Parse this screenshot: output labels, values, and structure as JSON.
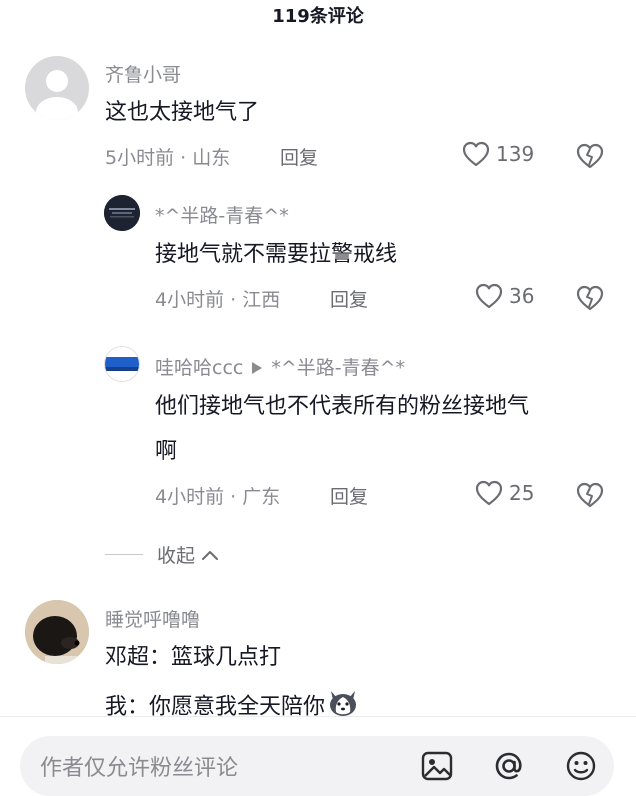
{
  "header": {
    "title": "119条评论"
  },
  "comments": [
    {
      "user": "齐鲁小哥",
      "text": "这也太接地气了",
      "meta": "5小时前 · 山东",
      "reply_label": "回复",
      "likes": "139"
    },
    {
      "user": "*^半路-青春^*",
      "text": "接地气就不需要拉警戒线",
      "meta": "4小时前 · 江西",
      "reply_label": "回复",
      "likes": "36"
    },
    {
      "user": "哇哈哈ccc",
      "reply_to": "*^半路-青春^*",
      "text_line1": "他们接地气也不代表所有的粉丝接地气",
      "text_line2": "啊",
      "meta": "4小时前 · 广东",
      "reply_label": "回复",
      "likes": "25"
    },
    {
      "user": "睡觉呼噜噜",
      "text_line1": "邓超：篮球几点打",
      "text_line2": "我：你愿意我全天陪你"
    }
  ],
  "collapse_label": "收起",
  "input": {
    "placeholder": "作者仅允许粉丝评论"
  },
  "icons": [
    "user-default-icon",
    "heart-icon",
    "dislike-heart-icon",
    "chevron-up-icon",
    "reply-arrow-icon",
    "image-icon",
    "at-icon",
    "emoji-icon",
    "husky-emoji-icon"
  ],
  "colors": {
    "text": "#161823",
    "secondary": "#8a8b91",
    "input_bg": "#f2f2f4"
  }
}
